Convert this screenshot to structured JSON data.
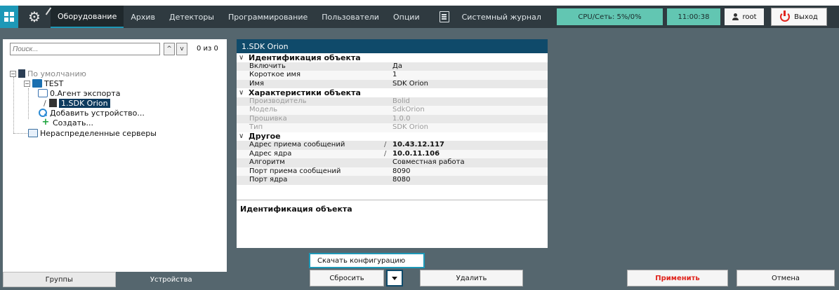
{
  "topbar": {
    "menu": [
      "Оборудование",
      "Архив",
      "Детекторы",
      "Программирование",
      "Пользователи",
      "Опции"
    ],
    "journal": "Системный журнал",
    "cpu": "CPU/Сеть: 5%/0%",
    "time": "11:00:38",
    "user": "root",
    "exit": "Выход"
  },
  "left": {
    "search_placeholder": "Поиск...",
    "count": "0 из 0",
    "tree": {
      "default": "По умолчанию",
      "test": "TEST",
      "agent": "0.Агент экспорта",
      "device": "1.SDK Orion",
      "add": "Добавить устройство...",
      "create": "Создать...",
      "unassigned": "Нераспределенные серверы"
    },
    "tabs": [
      "Группы",
      "Устройства"
    ]
  },
  "panel": {
    "title": "1.SDK Orion",
    "sections": [
      {
        "name": "Идентификация объекта",
        "rows": [
          {
            "key": "Включить",
            "value": "Да"
          },
          {
            "key": "Короткое имя",
            "value": "1"
          },
          {
            "key": "Имя",
            "value": "SDK Orion"
          }
        ]
      },
      {
        "name": "Характеристики объекта",
        "rows": [
          {
            "key": "Производитель",
            "value": "Bolid"
          },
          {
            "key": "Модель",
            "value": "SdkOrion"
          },
          {
            "key": "Прошивка",
            "value": "1.0.0"
          },
          {
            "key": "Тип",
            "value": "SDK Orion"
          }
        ]
      },
      {
        "name": "Другое",
        "rows": [
          {
            "key": "Адрес приема сообщений",
            "value": "10.43.12.117"
          },
          {
            "key": "Адрес ядра",
            "value": "10.0.11.106"
          },
          {
            "key": "Алгоритм",
            "value": "Совместная работа"
          },
          {
            "key": "Порт приема сообщений",
            "value": "8090"
          },
          {
            "key": "Порт ядра",
            "value": "8080"
          }
        ]
      }
    ],
    "description": "Идентификация объекта"
  },
  "popup": "Скачать конфигурацию",
  "buttons": {
    "reset": "Сбросить",
    "delete": "Удалить",
    "apply": "Применить",
    "cancel": "Отмена"
  },
  "colors": {
    "accent": "#1d98b7",
    "header_dark": "#2f3a40",
    "panel_title": "#0f4a6a",
    "status_green": "#62c6b2",
    "danger": "#e0231c",
    "background": "#55666e"
  }
}
